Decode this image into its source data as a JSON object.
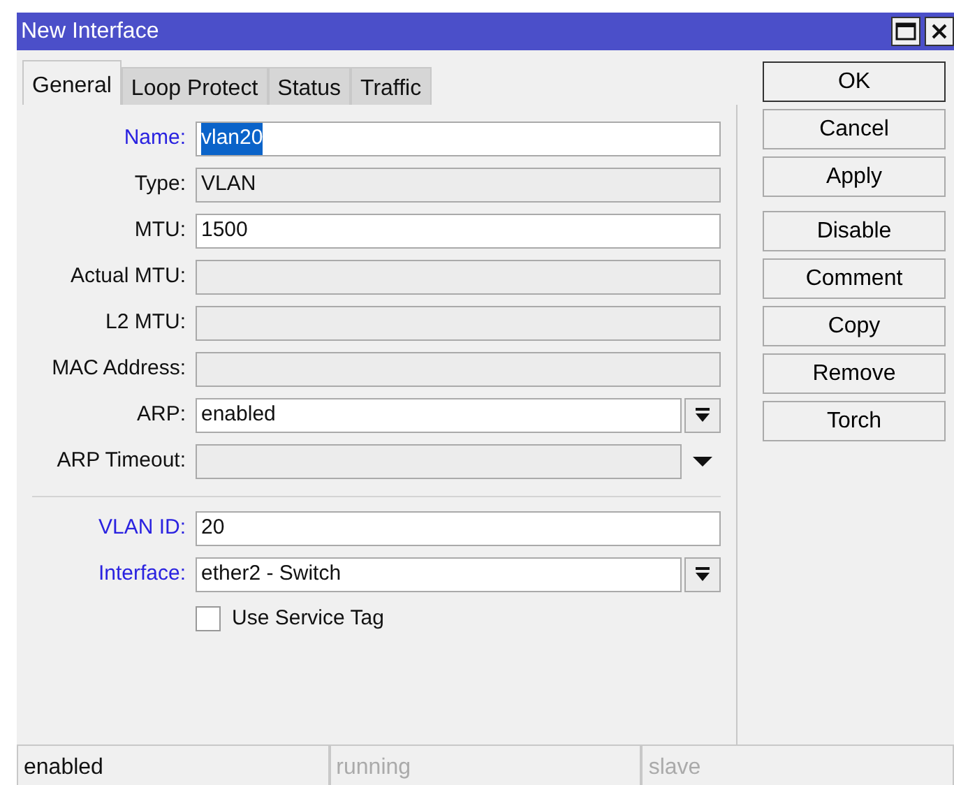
{
  "window": {
    "title": "New Interface"
  },
  "tabs": [
    {
      "label": "General",
      "selected": true
    },
    {
      "label": "Loop Protect",
      "selected": false
    },
    {
      "label": "Status",
      "selected": false
    },
    {
      "label": "Traffic",
      "selected": false
    }
  ],
  "fields": [
    {
      "label": "Name:",
      "kind": "text",
      "value": "vlan20",
      "required": true,
      "highlighted": true
    },
    {
      "label": "Type:",
      "kind": "readonly",
      "value": "VLAN",
      "required": false
    },
    {
      "label": "MTU:",
      "kind": "text",
      "value": "1500",
      "required": false
    },
    {
      "label": "Actual MTU:",
      "kind": "readonly",
      "required": false
    },
    {
      "label": "L2 MTU:",
      "kind": "readonly",
      "required": false
    },
    {
      "label": "MAC Address:",
      "kind": "readonly",
      "required": false
    },
    {
      "label": "ARP:",
      "kind": "dropdown",
      "value": "enabled",
      "required": false
    },
    {
      "label": "ARP Timeout:",
      "kind": "combo",
      "required": false
    },
    {
      "kind": "separator"
    },
    {
      "label": "VLAN ID:",
      "kind": "text",
      "value": "20",
      "required": true
    },
    {
      "label": "Interface:",
      "kind": "dropdown",
      "value": "ether2 - Switch",
      "required": true
    },
    {
      "label": "Use Service Tag",
      "kind": "checkbox",
      "checked": false
    }
  ],
  "button_groups": [
    [
      {
        "label": "OK",
        "default": true
      },
      {
        "label": "Cancel"
      },
      {
        "label": "Apply"
      }
    ],
    [
      {
        "label": "Disable"
      },
      {
        "label": "Comment"
      },
      {
        "label": "Copy"
      },
      {
        "label": "Remove"
      },
      {
        "label": "Torch"
      }
    ]
  ],
  "status_bar": [
    {
      "text": "enabled",
      "active": true
    },
    {
      "text": "running",
      "active": false
    },
    {
      "text": "slave",
      "active": false
    }
  ]
}
